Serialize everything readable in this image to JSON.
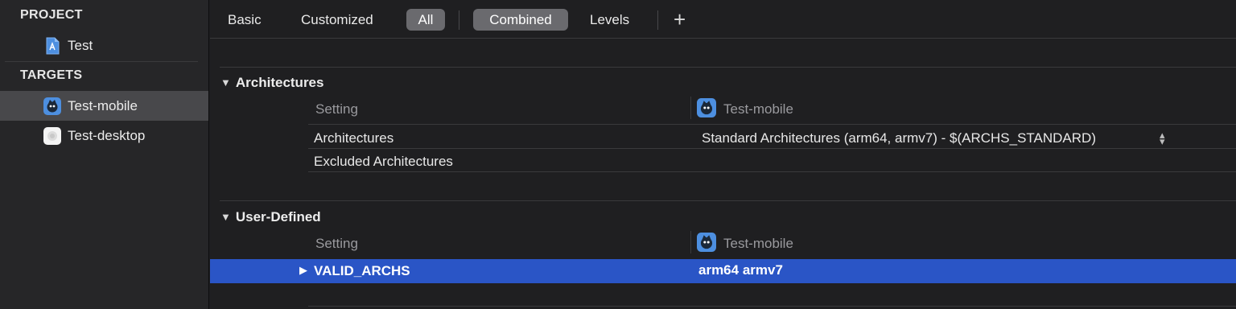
{
  "sidebar": {
    "project_header": "PROJECT",
    "project_item": "Test",
    "targets_header": "TARGETS",
    "targets": [
      {
        "label": "Test-mobile",
        "selected": true
      },
      {
        "label": "Test-desktop",
        "selected": false
      }
    ]
  },
  "toolbar": {
    "basic": "Basic",
    "customized": "Customized",
    "all": "All",
    "combined": "Combined",
    "levels": "Levels",
    "add": "+"
  },
  "architectures": {
    "title": "Architectures",
    "col_setting": "Setting",
    "col_target": "Test-mobile",
    "rows": [
      {
        "key": "Architectures",
        "value": "Standard Architectures (arm64, armv7)  -  $(ARCHS_STANDARD)"
      },
      {
        "key": "Excluded Architectures",
        "value": ""
      }
    ]
  },
  "user_defined": {
    "title": "User-Defined",
    "col_setting": "Setting",
    "col_target": "Test-mobile",
    "rows": [
      {
        "key": "VALID_ARCHS",
        "value": "arm64 armv7",
        "selected": true
      }
    ]
  },
  "colors": {
    "selection": "#2a55c6",
    "sidebar_selected": "#48484b",
    "active_segment": "#6a6a6e"
  }
}
